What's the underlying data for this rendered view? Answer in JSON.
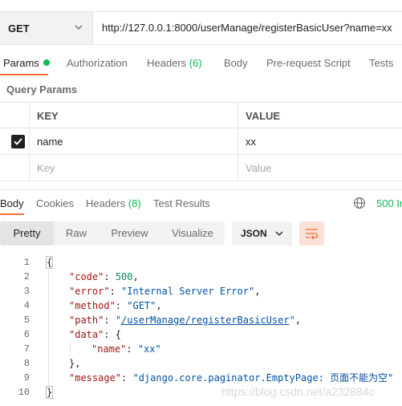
{
  "request": {
    "method": "GET",
    "url": "http://127.0.0.1:8000/userManage/registerBasicUser?name=xx"
  },
  "request_tabs": {
    "params": "Params",
    "authorization": "Authorization",
    "headers": "Headers",
    "headers_count": "(6)",
    "body": "Body",
    "pre_request": "Pre-request Script",
    "tests": "Tests"
  },
  "query_params": {
    "title": "Query Params",
    "key_header": "KEY",
    "value_header": "VALUE",
    "rows": [
      {
        "checked": true,
        "key": "name",
        "value": "xx"
      }
    ],
    "placeholder_key": "Key",
    "placeholder_value": "Value"
  },
  "response_tabs": {
    "body": "Body",
    "cookies": "Cookies",
    "headers": "Headers",
    "headers_count": "(8)",
    "test_results": "Test Results",
    "status": "500 In"
  },
  "response_toolbar": {
    "pretty": "Pretty",
    "raw": "Raw",
    "preview": "Preview",
    "visualize": "Visualize",
    "format": "JSON"
  },
  "code": {
    "line_numbers": [
      "1",
      "2",
      "3",
      "4",
      "5",
      "6",
      "7",
      "8",
      "9",
      "10"
    ],
    "lines": [
      {
        "parts": [
          [
            "p",
            "{"
          ]
        ]
      },
      {
        "parts": [
          [
            "k",
            "\"code\""
          ],
          [
            "p",
            ": "
          ],
          [
            "n",
            "500"
          ],
          [
            "p",
            ","
          ]
        ]
      },
      {
        "parts": [
          [
            "k",
            "\"error\""
          ],
          [
            "p",
            ": "
          ],
          [
            "s",
            "\"Internal Server Error\""
          ],
          [
            "p",
            ","
          ]
        ]
      },
      {
        "parts": [
          [
            "k",
            "\"method\""
          ],
          [
            "p",
            ": "
          ],
          [
            "s",
            "\"GET\""
          ],
          [
            "p",
            ","
          ]
        ]
      },
      {
        "parts": [
          [
            "k",
            "\"path\""
          ],
          [
            "p",
            ": "
          ],
          [
            "s",
            "\""
          ],
          [
            "u",
            "/userManage/registerBasicUser"
          ],
          [
            "s",
            "\""
          ],
          [
            "p",
            ","
          ]
        ]
      },
      {
        "parts": [
          [
            "k",
            "\"data\""
          ],
          [
            "p",
            ": {"
          ]
        ]
      },
      {
        "parts": [
          [
            "k",
            "\"name\""
          ],
          [
            "p",
            ": "
          ],
          [
            "s",
            "\"xx\""
          ]
        ]
      },
      {
        "parts": [
          [
            "p",
            "},"
          ]
        ]
      },
      {
        "parts": [
          [
            "k",
            "\"message\""
          ],
          [
            "p",
            ": "
          ],
          [
            "s",
            "\"django.core.paginator.EmptyPage: 页面不能为空\""
          ]
        ]
      },
      {
        "parts": [
          [
            "p",
            "}"
          ]
        ]
      }
    ]
  },
  "watermark": "https://blog.csdn.net/a232884c",
  "colors": {
    "accent": "#ff6c37",
    "success": "#0cbb52"
  },
  "icons": [
    "chevron-down-icon",
    "checkbox-checked-icon",
    "globe-icon",
    "wrap-lines-icon"
  ]
}
